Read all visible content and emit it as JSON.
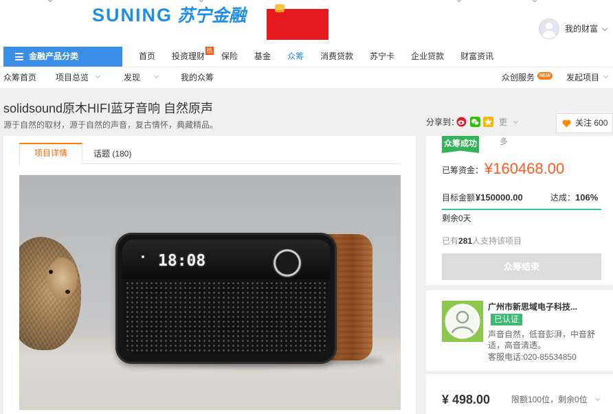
{
  "theme": {
    "brand_blue": "#1e8ee6",
    "nav_button_blue": "#3a8ee6",
    "accent_orange": "#ff6600",
    "amount_red": "#ff5a1f",
    "success_green": "#36b35a",
    "progress_green": "#38c29c"
  },
  "header": {
    "logo_text": "SUNING",
    "logo_cn": "苏宁金融",
    "account_label": "我的财富"
  },
  "nav": {
    "category_button": "金融产品分类",
    "items": [
      {
        "label": "首页"
      },
      {
        "label": "投资理财",
        "badge": "热"
      },
      {
        "label": "保险"
      },
      {
        "label": "基金"
      },
      {
        "label": "众筹",
        "active": true
      },
      {
        "label": "消费贷款"
      },
      {
        "label": "苏宁卡"
      },
      {
        "label": "企业贷款"
      },
      {
        "label": "财富资讯"
      }
    ]
  },
  "subnav": {
    "left": [
      {
        "label": "众筹首页"
      },
      {
        "label": "项目总览"
      },
      {
        "label": "发现"
      },
      {
        "label": "我的众筹"
      }
    ],
    "right": [
      {
        "label": "众创服务",
        "badge": "NEW"
      },
      {
        "label": "发起项目"
      }
    ]
  },
  "project": {
    "title": "solidsound原木HIFI蓝牙音响 自然原声",
    "subtitle": "源于自然的取材，源于自然的声音，复古情怀，典藏精品。",
    "share_label": "分享到：",
    "share_icons": [
      "weibo-icon",
      "wechat-icon",
      "qzone-icon"
    ],
    "share_more": "更",
    "follow_label": "关注",
    "follow_count": "600"
  },
  "tabs": [
    {
      "label": "项目详情",
      "active": true
    },
    {
      "label": "话题 (180)"
    }
  ],
  "product_image": {
    "display_text": "18:08"
  },
  "funding": {
    "status_badge": "众筹成功",
    "more_label": "多",
    "raised_label": "已筹资金：",
    "raised_amount": "¥160468.00",
    "target_label": "目标金额：",
    "target_amount": "¥150000.00",
    "achieved_label": "达成：",
    "achieved_percent": "106%",
    "progress_percent": 106,
    "remaining": "剩余0天",
    "supporters_prefix": "已有",
    "supporters_count": "281",
    "supporters_suffix": "人支持该项目",
    "end_button": "众筹结束"
  },
  "company": {
    "name": "广州市新思域电子科技...",
    "verified_badge": "已认证",
    "description": "声音自然，低音彭湃，中音舒适，高音清透。",
    "phone": "客服电话:020-85534850"
  },
  "reward": {
    "price": "¥ 498.00",
    "limit": "限额100位，剩余0位"
  }
}
